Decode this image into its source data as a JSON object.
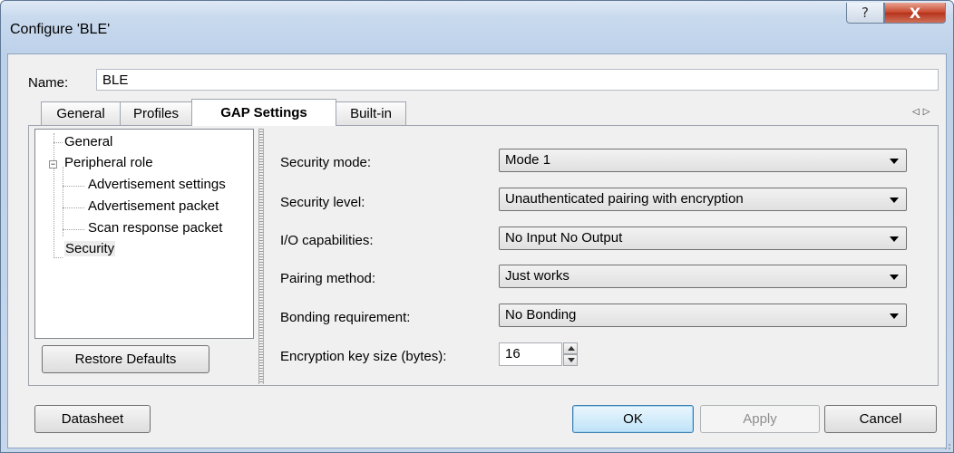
{
  "window": {
    "title": "Configure 'BLE'",
    "help_glyph": "?",
    "close_glyph": "X",
    "close_color": "#c8442a"
  },
  "name": {
    "label": "Name:",
    "value": "BLE"
  },
  "tabs": [
    {
      "label": "General",
      "active": false
    },
    {
      "label": "Profiles",
      "active": false
    },
    {
      "label": "GAP Settings",
      "active": true
    },
    {
      "label": "Built-in",
      "active": false
    }
  ],
  "tab_scroll": {
    "left": "◁",
    "right": "▷"
  },
  "tree": {
    "items": [
      {
        "label": "General",
        "level": 0
      },
      {
        "label": "Peripheral role",
        "level": 0,
        "expanded": true
      },
      {
        "label": "Advertisement settings",
        "level": 1
      },
      {
        "label": "Advertisement packet",
        "level": 1
      },
      {
        "label": "Scan response packet",
        "level": 1
      },
      {
        "label": "Security",
        "level": 0,
        "selected": true
      }
    ],
    "expander_glyph": "−"
  },
  "restore_defaults_label": "Restore Defaults",
  "security": {
    "mode": {
      "label": "Security mode:",
      "value": "Mode 1"
    },
    "level": {
      "label": "Security level:",
      "value": "Unauthenticated pairing with encryption"
    },
    "io": {
      "label": "I/O capabilities:",
      "value": "No Input No Output"
    },
    "pairing": {
      "label": "Pairing method:",
      "value": "Just works"
    },
    "bonding": {
      "label": "Bonding requirement:",
      "value": "No Bonding"
    },
    "key_size": {
      "label": "Encryption key size (bytes):",
      "value": "16"
    }
  },
  "footer": {
    "datasheet": "Datasheet",
    "ok": "OK",
    "apply": "Apply",
    "cancel": "Cancel"
  }
}
